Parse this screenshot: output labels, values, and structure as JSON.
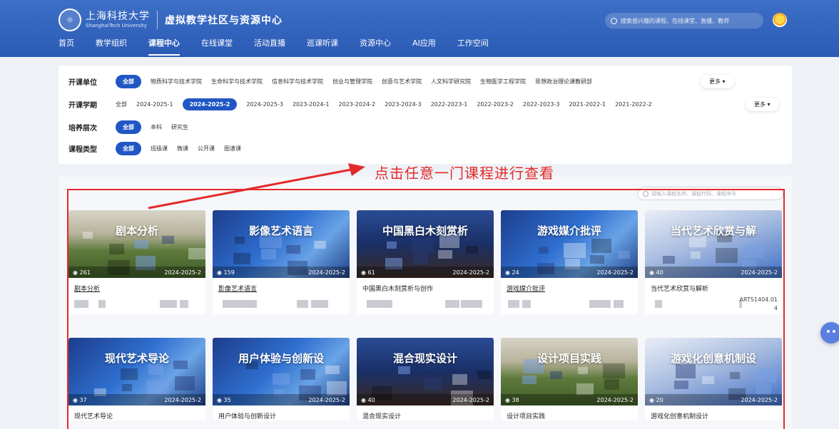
{
  "header": {
    "logo_seal": "☼",
    "university_cn": "上海科技大学",
    "university_en": "ShanghaiTech University",
    "site_title": "虚拟教学社区与资源中心",
    "search_placeholder": "搜索感兴趣的课程、在线课堂、直播、教师"
  },
  "nav": [
    "首页",
    "教学组织",
    "课程中心",
    "在线课堂",
    "活动直播",
    "巡课听课",
    "资源中心",
    "AI应用",
    "工作空间"
  ],
  "nav_active": "课程中心",
  "filters": {
    "department": {
      "label": "开课单位",
      "options": [
        "全部",
        "物质科学与技术学院",
        "生命科学与技术学院",
        "信息科学与技术学院",
        "创业与管理学院",
        "创意与艺术学院",
        "人文科学研究院",
        "生物医学工程学院",
        "思想政治理论课教研部"
      ],
      "selected": "全部",
      "more": "更多 ▾"
    },
    "semester": {
      "label": "开课学期",
      "options": [
        "全部",
        "2024-2025-1",
        "2024-2025-2",
        "2024-2025-3",
        "2023-2024-1",
        "2023-2024-2",
        "2023-2024-3",
        "2022-2023-1",
        "2022-2023-2",
        "2022-2023-3",
        "2021-2022-1",
        "2021-2022-2"
      ],
      "selected": "2024-2025-2",
      "more": "更多 ▾"
    },
    "level": {
      "label": "培养层次",
      "options": [
        "全部",
        "本科",
        "研究生"
      ],
      "selected": "全部"
    },
    "type": {
      "label": "课程类型",
      "options": [
        "全部",
        "班级课",
        "微课",
        "公开课",
        "图谱课"
      ],
      "selected": "全部"
    }
  },
  "annotation": "点击任意一门课程进行查看",
  "course_search_placeholder": "请输入课程名称、课程代码、课程序号",
  "courses": [
    {
      "cover_title": "剧本分析",
      "views": "261",
      "term": "2024-2025-2",
      "name": "剧本分析",
      "theme": "field",
      "underline": true,
      "code": ""
    },
    {
      "cover_title": "影像艺术语言",
      "views": "159",
      "term": "2024-2025-2",
      "name": "影像艺术语言",
      "theme": "blue",
      "underline": true,
      "code": ""
    },
    {
      "cover_title": "中国黑白木刻赏析",
      "views": "61",
      "term": "2024-2025-2",
      "name": "中国黑白木刻赏析与创作",
      "theme": "dark",
      "underline": false,
      "code": ""
    },
    {
      "cover_title": "游戏媒介批评",
      "views": "24",
      "term": "2024-2025-2",
      "name": "游戏媒介批评",
      "theme": "blue",
      "underline": true,
      "code": ""
    },
    {
      "cover_title": "当代艺术欣赏与解",
      "views": "40",
      "term": "2024-2025-2",
      "name": "当代艺术欣赏与解析",
      "theme": "light",
      "underline": false,
      "code": "ARTS1404.01\n4"
    },
    {
      "cover_title": "现代艺术导论",
      "views": "37",
      "term": "2024-2025-2",
      "name": "现代艺术导论",
      "theme": "blue",
      "underline": false,
      "code": ""
    },
    {
      "cover_title": "用户体验与创新设",
      "views": "35",
      "term": "2024-2025-2",
      "name": "用户体验与创新设计",
      "theme": "blue",
      "underline": false,
      "code": ""
    },
    {
      "cover_title": "混合现实设计",
      "views": "40",
      "term": "2024-2025-2",
      "name": "混合现实设计",
      "theme": "dark",
      "underline": false,
      "code": ""
    },
    {
      "cover_title": "设计项目实践",
      "views": "38",
      "term": "2024-2025-2",
      "name": "设计项目实践",
      "theme": "field",
      "underline": false,
      "code": ""
    },
    {
      "cover_title": "游戏化创意机制设",
      "views": "20",
      "term": "2024-2025-2",
      "name": "游戏化创意机制设计",
      "theme": "light",
      "underline": false,
      "code": ""
    }
  ],
  "colors": {
    "primary": "#2157c4",
    "header": "#2b5bb5",
    "annotation": "#e32a2a"
  },
  "icons": {
    "view": "eye-icon",
    "search": "search-icon",
    "assistant": "robot-assistant-icon"
  }
}
